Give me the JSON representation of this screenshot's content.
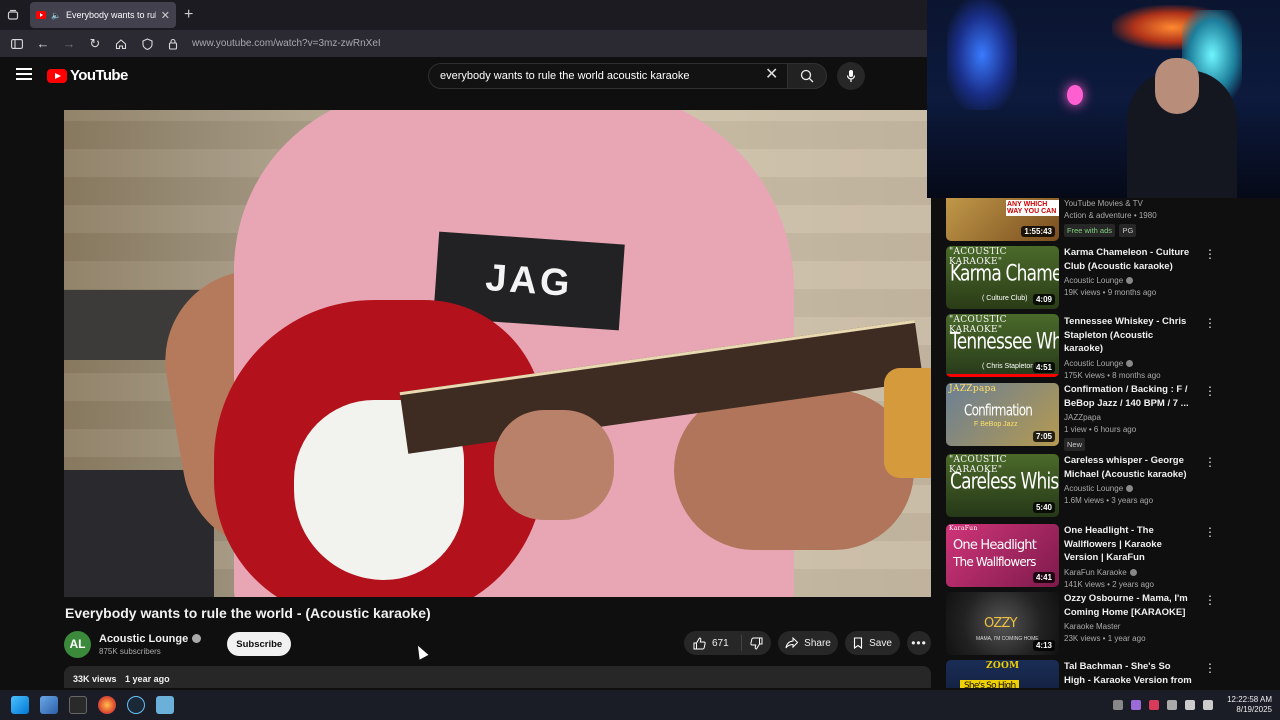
{
  "browser": {
    "tab_title": "Everybody wants to rule the",
    "url": "www.youtube.com/watch?v=3mz-zwRnXeI"
  },
  "youtube": {
    "logo_text": "YouTube",
    "search_query": "everybody wants to rule the world acoustic karaoke"
  },
  "video": {
    "shirt_text": "JAG",
    "title": "Everybody wants to rule the world - (Acoustic karaoke)",
    "channel": {
      "avatar_text": "AL",
      "name": "Acoustic Lounge",
      "subscribers": "875K subscribers",
      "subscribe_label": "Subscribe"
    },
    "likes": "671",
    "share_label": "Share",
    "save_label": "Save",
    "views": "33K views",
    "age": "1 year ago"
  },
  "recommendations": [
    {
      "thumb_text": "ANY WHICH WAY YOU CAN",
      "duration": "1:55:43",
      "title": "",
      "channel": "YouTube Movies & TV",
      "views": "Action & adventure • 1980",
      "badges": [
        "Free with ads",
        "PG"
      ]
    },
    {
      "thumb_top": "\"ACOUSTIC KARAOKE\"",
      "thumb_main": "Karma Chameleon",
      "thumb_sub": "( Culture Club)",
      "duration": "4:09",
      "title": "Karma Chameleon - Culture Club (Acoustic karaoke)",
      "channel": "Acoustic Lounge",
      "views": "19K views • 9 months ago"
    },
    {
      "thumb_top": "\"ACOUSTIC KARAOKE\"",
      "thumb_main": "Tennessee Whiskey",
      "thumb_sub": "( Chris Stapleton)",
      "duration": "4:51",
      "title": "Tennessee Whiskey - Chris Stapleton (Acoustic karaoke)",
      "channel": "Acoustic Lounge",
      "views": "175K views • 8 months ago"
    },
    {
      "thumb_top": "JAZZpapa",
      "thumb_main": "Confirmation",
      "thumb_sub": "F BeBop Jazz",
      "duration": "7:05",
      "title": "Confirmation / Backing : F / BeBop Jazz / 140 BPM / 7 ...",
      "channel": "JAZZpapa",
      "views": "1 view • 6 hours ago",
      "badges": [
        "New"
      ]
    },
    {
      "thumb_top": "\"ACOUSTIC KARAOKE\"",
      "thumb_main": "Careless Whisper",
      "thumb_sub": "",
      "duration": "5:40",
      "title": "Careless whisper - George Michael (Acoustic karaoke)",
      "channel": "Acoustic Lounge",
      "views": "1.6M views • 3 years ago"
    },
    {
      "thumb_top": "KaraFun",
      "thumb_main": "One Headlight",
      "thumb_sub": "The Wallflowers",
      "duration": "4:41",
      "title": "One Headlight - The Wallflowers | Karaoke Version | KaraFun",
      "channel": "KaraFun Karaoke",
      "views": "141K views • 2 years ago"
    },
    {
      "thumb_top": "",
      "thumb_main": "OZZY",
      "thumb_sub": "MAMA, I'M COMING HOME",
      "duration": "4:13",
      "title": "Ozzy Osbourne - Mama, I'm Coming Home [KARAOKE]",
      "channel": "Karaoke Master",
      "views": "23K views • 1 year ago"
    },
    {
      "thumb_top": "ZOOM",
      "thumb_main": "She's So High",
      "thumb_sub": "",
      "duration": "",
      "title": "Tal Bachman - She's So High - Karaoke Version from Zoom ...",
      "channel": "",
      "views": ""
    }
  ],
  "taskbar": {
    "time": "12:22:58 AM",
    "date": "8/19/2025"
  }
}
